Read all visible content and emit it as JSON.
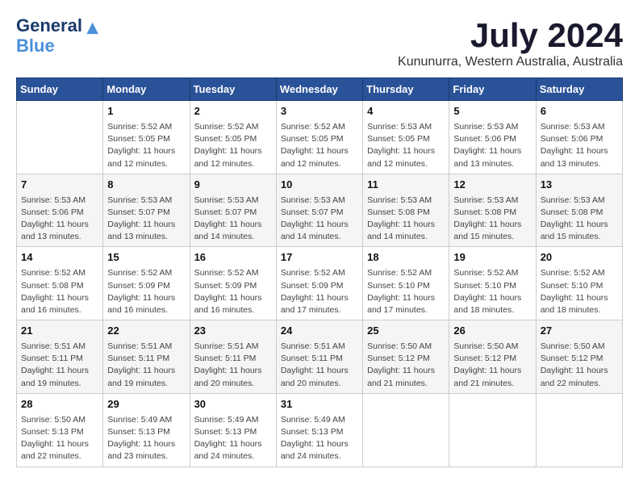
{
  "logo": {
    "line1": "General",
    "line2": "Blue"
  },
  "title": "July 2024",
  "subtitle": "Kununurra, Western Australia, Australia",
  "days_header": [
    "Sunday",
    "Monday",
    "Tuesday",
    "Wednesday",
    "Thursday",
    "Friday",
    "Saturday"
  ],
  "weeks": [
    [
      {
        "day": "",
        "content": ""
      },
      {
        "day": "1",
        "content": "Sunrise: 5:52 AM\nSunset: 5:05 PM\nDaylight: 11 hours\nand 12 minutes."
      },
      {
        "day": "2",
        "content": "Sunrise: 5:52 AM\nSunset: 5:05 PM\nDaylight: 11 hours\nand 12 minutes."
      },
      {
        "day": "3",
        "content": "Sunrise: 5:52 AM\nSunset: 5:05 PM\nDaylight: 11 hours\nand 12 minutes."
      },
      {
        "day": "4",
        "content": "Sunrise: 5:53 AM\nSunset: 5:05 PM\nDaylight: 11 hours\nand 12 minutes."
      },
      {
        "day": "5",
        "content": "Sunrise: 5:53 AM\nSunset: 5:06 PM\nDaylight: 11 hours\nand 13 minutes."
      },
      {
        "day": "6",
        "content": "Sunrise: 5:53 AM\nSunset: 5:06 PM\nDaylight: 11 hours\nand 13 minutes."
      }
    ],
    [
      {
        "day": "7",
        "content": "Sunrise: 5:53 AM\nSunset: 5:06 PM\nDaylight: 11 hours\nand 13 minutes."
      },
      {
        "day": "8",
        "content": "Sunrise: 5:53 AM\nSunset: 5:07 PM\nDaylight: 11 hours\nand 13 minutes."
      },
      {
        "day": "9",
        "content": "Sunrise: 5:53 AM\nSunset: 5:07 PM\nDaylight: 11 hours\nand 14 minutes."
      },
      {
        "day": "10",
        "content": "Sunrise: 5:53 AM\nSunset: 5:07 PM\nDaylight: 11 hours\nand 14 minutes."
      },
      {
        "day": "11",
        "content": "Sunrise: 5:53 AM\nSunset: 5:08 PM\nDaylight: 11 hours\nand 14 minutes."
      },
      {
        "day": "12",
        "content": "Sunrise: 5:53 AM\nSunset: 5:08 PM\nDaylight: 11 hours\nand 15 minutes."
      },
      {
        "day": "13",
        "content": "Sunrise: 5:53 AM\nSunset: 5:08 PM\nDaylight: 11 hours\nand 15 minutes."
      }
    ],
    [
      {
        "day": "14",
        "content": "Sunrise: 5:52 AM\nSunset: 5:08 PM\nDaylight: 11 hours\nand 16 minutes."
      },
      {
        "day": "15",
        "content": "Sunrise: 5:52 AM\nSunset: 5:09 PM\nDaylight: 11 hours\nand 16 minutes."
      },
      {
        "day": "16",
        "content": "Sunrise: 5:52 AM\nSunset: 5:09 PM\nDaylight: 11 hours\nand 16 minutes."
      },
      {
        "day": "17",
        "content": "Sunrise: 5:52 AM\nSunset: 5:09 PM\nDaylight: 11 hours\nand 17 minutes."
      },
      {
        "day": "18",
        "content": "Sunrise: 5:52 AM\nSunset: 5:10 PM\nDaylight: 11 hours\nand 17 minutes."
      },
      {
        "day": "19",
        "content": "Sunrise: 5:52 AM\nSunset: 5:10 PM\nDaylight: 11 hours\nand 18 minutes."
      },
      {
        "day": "20",
        "content": "Sunrise: 5:52 AM\nSunset: 5:10 PM\nDaylight: 11 hours\nand 18 minutes."
      }
    ],
    [
      {
        "day": "21",
        "content": "Sunrise: 5:51 AM\nSunset: 5:11 PM\nDaylight: 11 hours\nand 19 minutes."
      },
      {
        "day": "22",
        "content": "Sunrise: 5:51 AM\nSunset: 5:11 PM\nDaylight: 11 hours\nand 19 minutes."
      },
      {
        "day": "23",
        "content": "Sunrise: 5:51 AM\nSunset: 5:11 PM\nDaylight: 11 hours\nand 20 minutes."
      },
      {
        "day": "24",
        "content": "Sunrise: 5:51 AM\nSunset: 5:11 PM\nDaylight: 11 hours\nand 20 minutes."
      },
      {
        "day": "25",
        "content": "Sunrise: 5:50 AM\nSunset: 5:12 PM\nDaylight: 11 hours\nand 21 minutes."
      },
      {
        "day": "26",
        "content": "Sunrise: 5:50 AM\nSunset: 5:12 PM\nDaylight: 11 hours\nand 21 minutes."
      },
      {
        "day": "27",
        "content": "Sunrise: 5:50 AM\nSunset: 5:12 PM\nDaylight: 11 hours\nand 22 minutes."
      }
    ],
    [
      {
        "day": "28",
        "content": "Sunrise: 5:50 AM\nSunset: 5:13 PM\nDaylight: 11 hours\nand 22 minutes."
      },
      {
        "day": "29",
        "content": "Sunrise: 5:49 AM\nSunset: 5:13 PM\nDaylight: 11 hours\nand 23 minutes."
      },
      {
        "day": "30",
        "content": "Sunrise: 5:49 AM\nSunset: 5:13 PM\nDaylight: 11 hours\nand 24 minutes."
      },
      {
        "day": "31",
        "content": "Sunrise: 5:49 AM\nSunset: 5:13 PM\nDaylight: 11 hours\nand 24 minutes."
      },
      {
        "day": "",
        "content": ""
      },
      {
        "day": "",
        "content": ""
      },
      {
        "day": "",
        "content": ""
      }
    ]
  ]
}
